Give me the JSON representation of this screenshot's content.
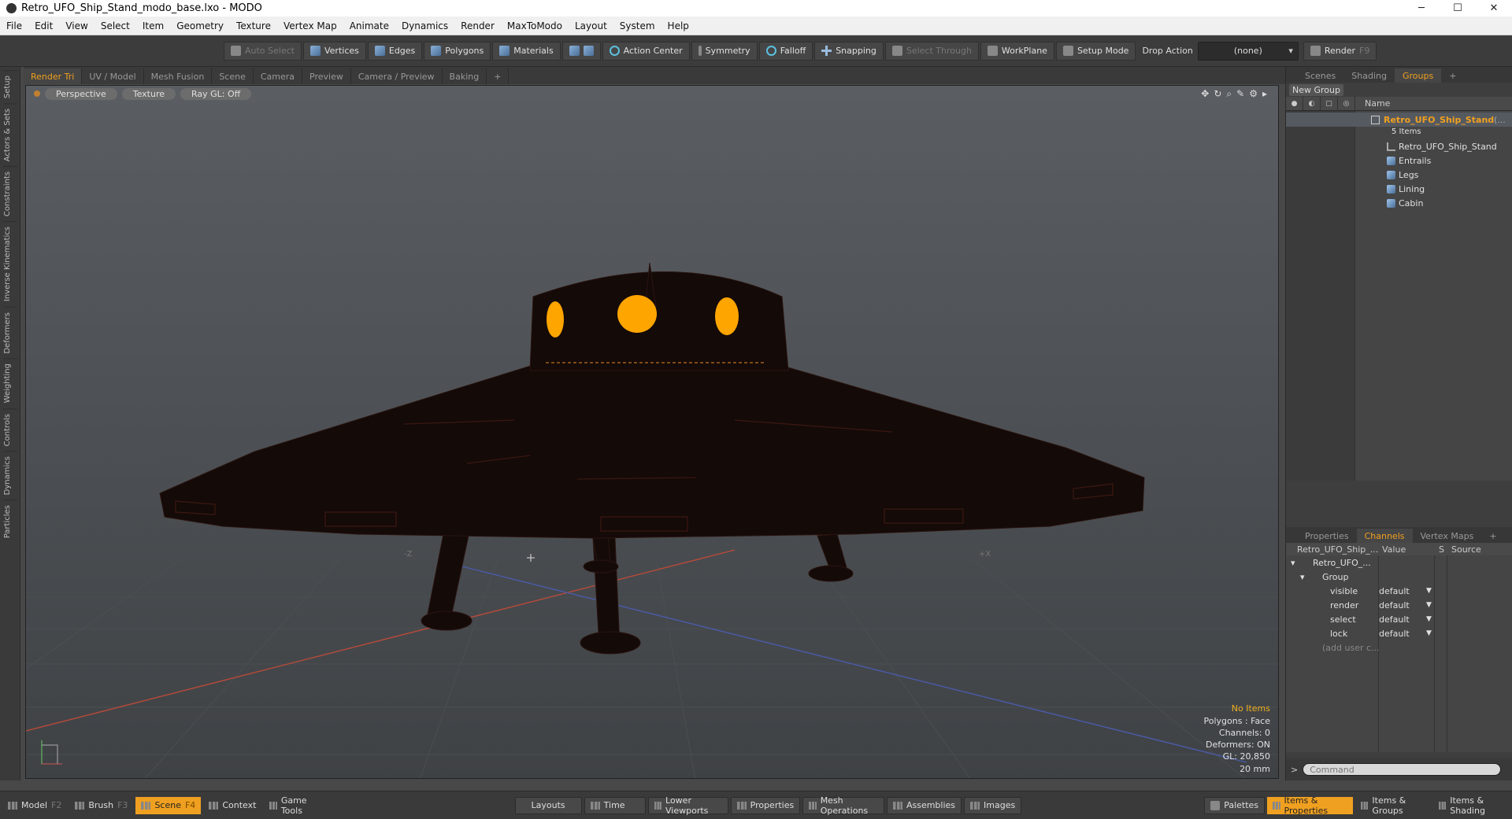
{
  "window": {
    "title": "Retro_UFO_Ship_Stand_modo_base.lxo - MODO"
  },
  "menu": [
    "File",
    "Edit",
    "View",
    "Select",
    "Item",
    "Geometry",
    "Texture",
    "Vertex Map",
    "Animate",
    "Dynamics",
    "Render",
    "MaxToModo",
    "Layout",
    "System",
    "Help"
  ],
  "toolbar": {
    "auto_select": "Auto Select",
    "vertices": "Vertices",
    "edges": "Edges",
    "polygons": "Polygons",
    "materials": "Materials",
    "action_center": "Action Center",
    "symmetry": "Symmetry",
    "falloff": "Falloff",
    "snapping": "Snapping",
    "select_through": "Select Through",
    "workplane": "WorkPlane",
    "setup_mode": "Setup Mode",
    "drop_action": "Drop Action",
    "drop_value": "(none)",
    "render": "Render",
    "render_key": "F9"
  },
  "left_tabs": [
    "Setup",
    "Actors & Sets",
    "Constraints",
    "Inverse Kinematics",
    "Deformers",
    "Weighting",
    "Controls",
    "Dynamics",
    "Particles"
  ],
  "viewport_tabs": [
    "Render Tri",
    "UV / Model",
    "Mesh Fusion",
    "Scene",
    "Camera",
    "Preview",
    "Camera / Preview",
    "Baking",
    "+"
  ],
  "viewport": {
    "perspective": "Perspective",
    "texture": "Texture",
    "raygl": "Ray GL: Off",
    "hud": {
      "items": "No Items",
      "polygons": "Polygons : Face",
      "channels": "Channels: 0",
      "deformers": "Deformers: ON",
      "gl": "GL: 20,850",
      "scale": "20 mm"
    },
    "axis_neg_z": "-Z",
    "axis_pos_x": "+X"
  },
  "groups_panel": {
    "tabs": [
      "Scenes",
      "Shading",
      "Groups",
      "+"
    ],
    "new_group": "New Group",
    "name_header": "Name",
    "root": "Retro_UFO_Ship_Stand",
    "root_suffix": "(...",
    "count": "5 Items",
    "children": [
      "Retro_UFO_Ship_Stand",
      "Entrails",
      "Legs",
      "Lining",
      "Cabin"
    ]
  },
  "channels_panel": {
    "tabs": [
      "Properties",
      "Channels",
      "Vertex Maps",
      "+"
    ],
    "col_item": "Retro_UFO_Ship_...",
    "col_value": "Value",
    "col_s": "S",
    "col_source": "Source",
    "item": "Retro_UFO_...",
    "group": "Group",
    "rows": [
      {
        "name": "visible",
        "value": "default"
      },
      {
        "name": "render",
        "value": "default"
      },
      {
        "name": "select",
        "value": "default"
      },
      {
        "name": "lock",
        "value": "default"
      }
    ],
    "add_user": "(add user c...",
    "command_placeholder": "Command"
  },
  "statusbar": {
    "model": "Model",
    "model_key": "F2",
    "brush": "Brush",
    "brush_key": "F3",
    "scene": "Scene",
    "scene_key": "F4",
    "context": "Context",
    "game_tools": "Game Tools",
    "layouts": "Layouts",
    "time": "Time",
    "lower_viewports": "Lower Viewports",
    "properties": "Properties",
    "mesh_operations": "Mesh Operations",
    "assemblies": "Assemblies",
    "images": "Images",
    "palettes": "Palettes",
    "items_properties": "Items & Properties",
    "items_groups": "Items & Groups",
    "items_shading": "Items & Shading"
  },
  "colors": {
    "accent": "#f0a020",
    "window_glow": "#ffa500"
  }
}
